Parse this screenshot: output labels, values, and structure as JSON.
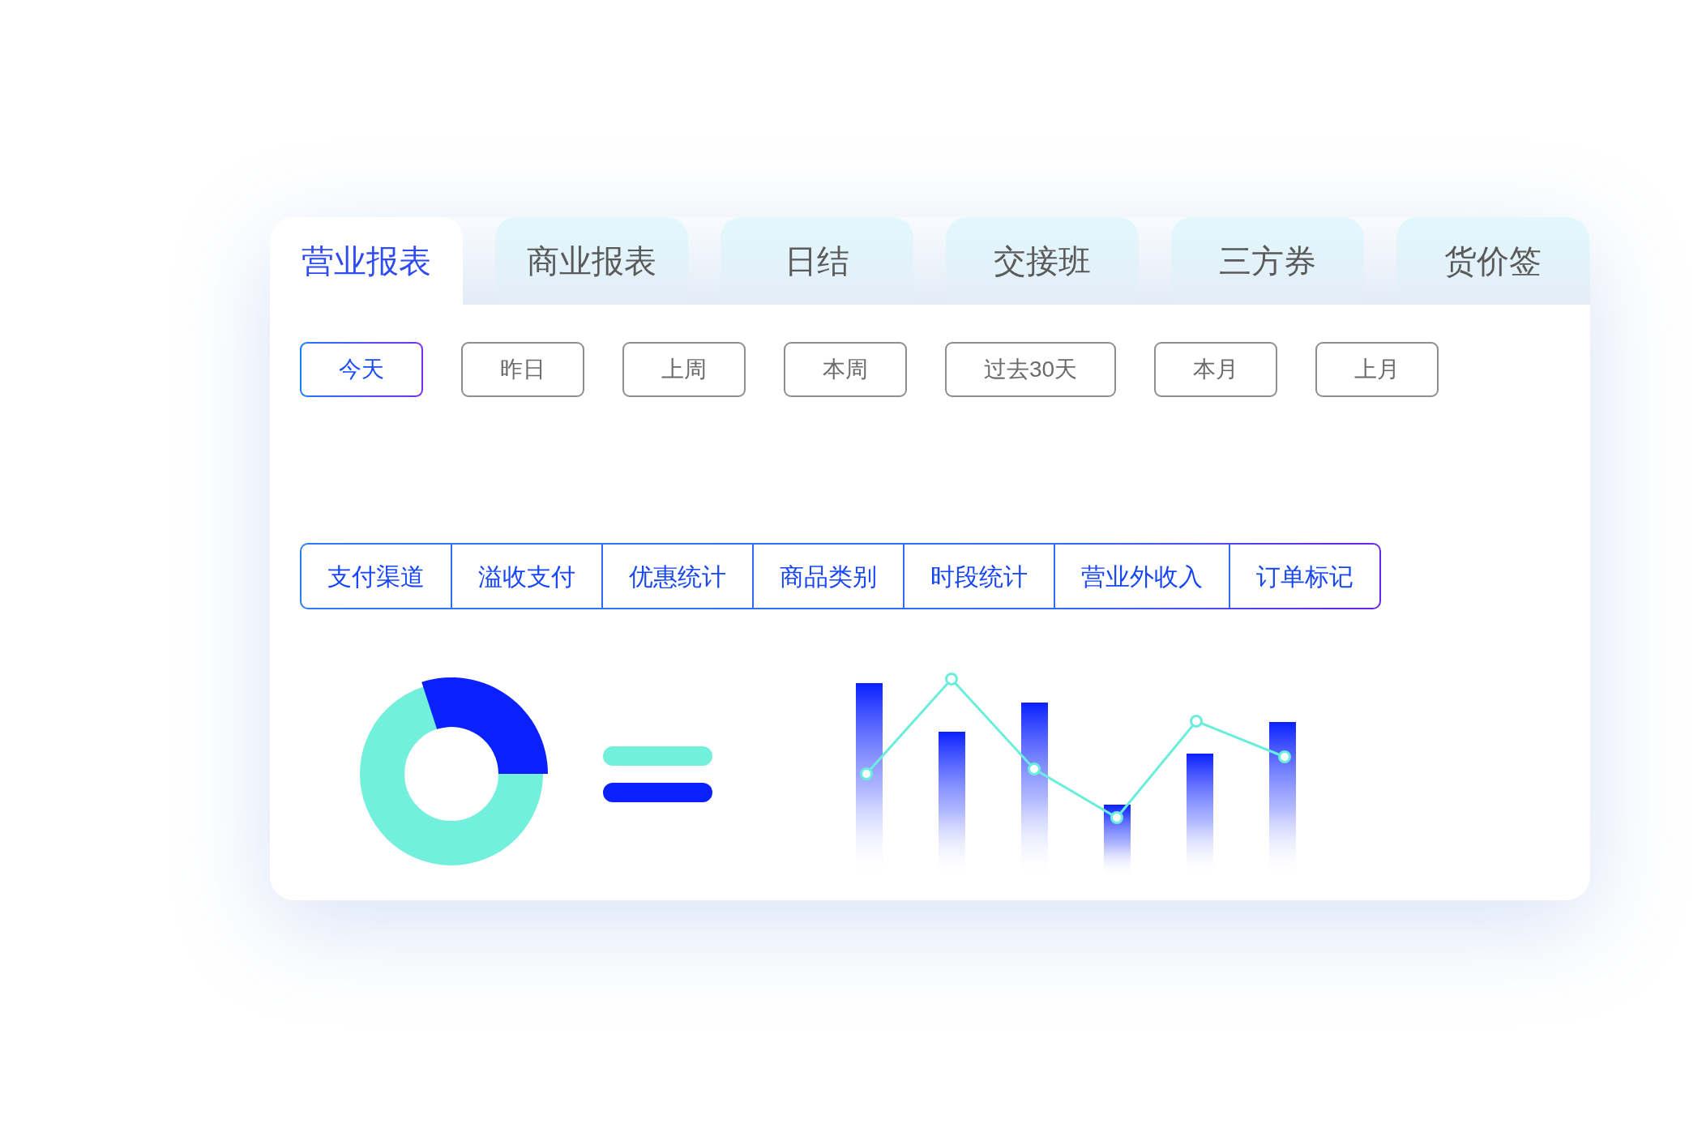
{
  "tabs": [
    {
      "label": "营业报表",
      "selected": true
    },
    {
      "label": "商业报表",
      "selected": false
    },
    {
      "label": "日结",
      "selected": false
    },
    {
      "label": "交接班",
      "selected": false
    },
    {
      "label": "三方券",
      "selected": false
    },
    {
      "label": "货价签",
      "selected": false
    }
  ],
  "date_filters": [
    {
      "label": "今天",
      "selected": true
    },
    {
      "label": "昨日",
      "selected": false
    },
    {
      "label": "上周",
      "selected": false
    },
    {
      "label": "本周",
      "selected": false
    },
    {
      "label": "过去30天",
      "selected": false
    },
    {
      "label": "本月",
      "selected": false
    },
    {
      "label": "上月",
      "selected": false
    }
  ],
  "report_categories": [
    {
      "label": "支付渠道",
      "selected": false
    },
    {
      "label": "溢收支付",
      "selected": false
    },
    {
      "label": "优惠统计",
      "selected": false
    },
    {
      "label": "商品类别",
      "selected": false
    },
    {
      "label": "时段统计",
      "selected": false
    },
    {
      "label": "营业外收入",
      "selected": false
    },
    {
      "label": "订单标记",
      "selected": false
    }
  ]
}
